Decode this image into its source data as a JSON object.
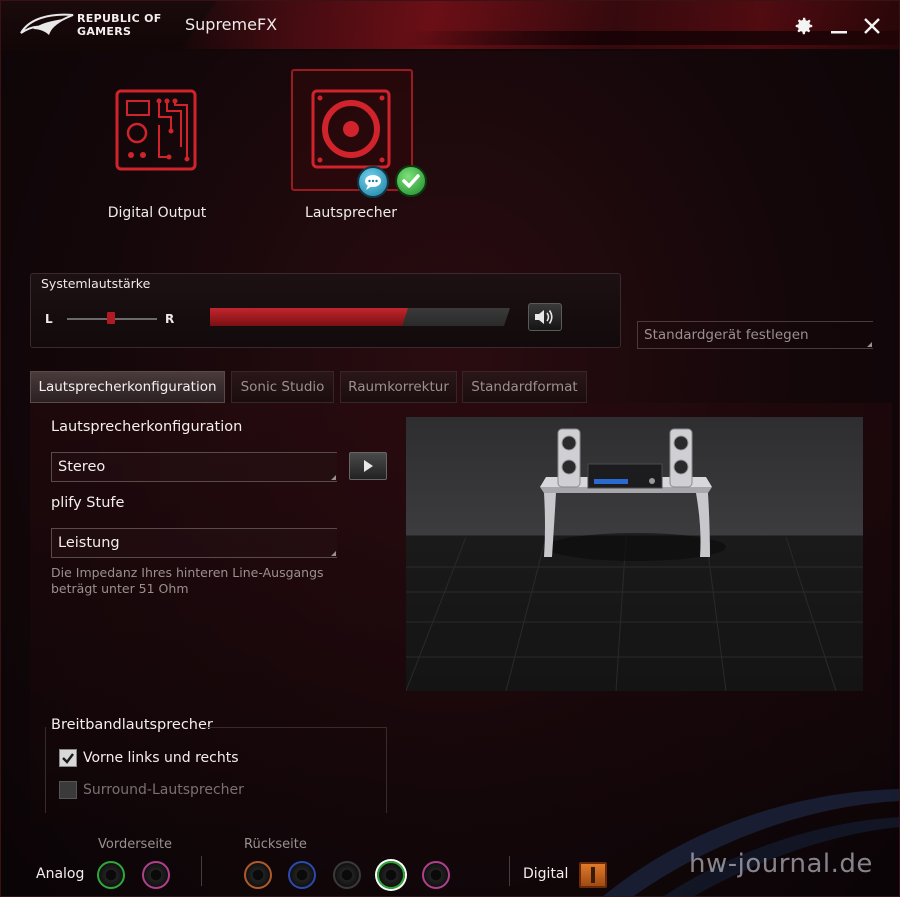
{
  "titlebar": {
    "brand_line1": "REPUBLIC OF",
    "brand_line2": "GAMERS",
    "app_title": "SupremeFX"
  },
  "devices": [
    {
      "label": "Digital Output",
      "icon": "motherboard-icon",
      "selected": false
    },
    {
      "label": "Lautsprecher",
      "icon": "speaker-icon",
      "selected": true
    }
  ],
  "volume": {
    "title": "Systemlautstärke",
    "left_label": "L",
    "right_label": "R",
    "level_fraction": 0.66,
    "balance_fraction": 0.5
  },
  "default_device_button": "Standardgerät festlegen",
  "tabs": [
    {
      "label": "Lautsprecherkonfiguration",
      "active": true
    },
    {
      "label": "Sonic Studio",
      "active": false
    },
    {
      "label": "Raumkorrektur",
      "active": false
    },
    {
      "label": "Standardformat",
      "active": false
    }
  ],
  "config": {
    "speaker_config_label": "Lautsprecherkonfiguration",
    "speaker_config_value": "Stereo",
    "amplify_label": "plify Stufe",
    "amplify_value": "Leistung",
    "hint": "Die Impedanz Ihres hinteren Line-Ausgangs beträgt unter 51 Ohm"
  },
  "broadband": {
    "title": "Breitbandlautsprecher",
    "front": {
      "label": "Vorne links und rechts",
      "checked": true
    },
    "surround": {
      "label": "Surround-Lautsprecher",
      "checked": false,
      "disabled": true
    }
  },
  "jacks": {
    "analog_label": "Analog",
    "front_label": "Vorderseite",
    "rear_label": "Rückseite",
    "digital_label": "Digital"
  },
  "watermark": "hw-journal.de",
  "colors": {
    "accent": "#b01a22",
    "jack_green": "#2fa83a",
    "jack_pink": "#b0408a",
    "jack_orange": "#b05a2a",
    "jack_blue": "#2a4ab0",
    "jack_black": "#222222"
  }
}
